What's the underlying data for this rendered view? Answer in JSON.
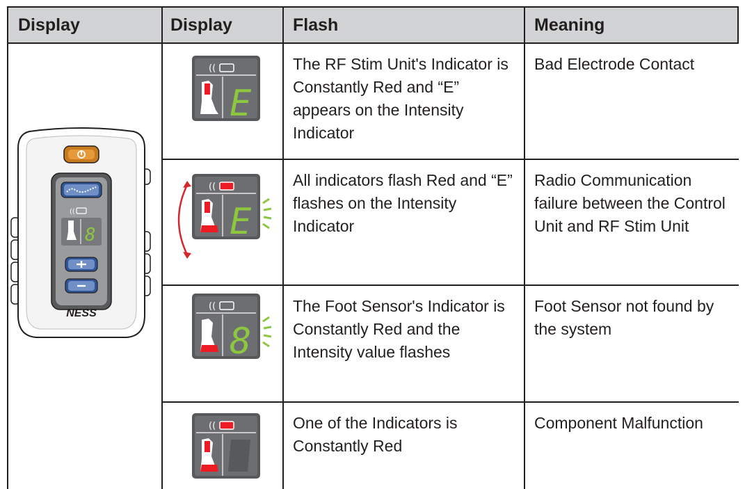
{
  "header": {
    "col1": "Display",
    "col2": "Display",
    "col3": "Flash",
    "col4": "Meaning"
  },
  "device": {
    "brand": "NESS",
    "intensity_digit": "8",
    "power_icon": "power-icon",
    "wave_icon": "stimulation-wave-icon",
    "plus_icon": "plus-icon",
    "minus_icon": "minus-icon"
  },
  "rows": [
    {
      "panel_digit": "E",
      "flash": "The RF Stim Unit's Indicator is Constantly Red and “E” appears on the Intensity Indicator",
      "meaning": "Bad Electrode Contact"
    },
    {
      "panel_digit": "E",
      "flash": "All indicators flash Red and “E” flashes on the Intensity Indicator",
      "meaning": "Radio Communication failure between the Control Unit and RF Stim Unit"
    },
    {
      "panel_digit": "8",
      "flash": "The Foot Sensor's Indicator is Constantly Red and the Intensity value flashes",
      "meaning": "Foot Sensor not found by the system"
    },
    {
      "panel_digit": "",
      "flash": "One of the Indicators is Constantly Red",
      "meaning": "Component Malfunction"
    }
  ],
  "colors": {
    "header_bg": "#d1d3d4",
    "panel_bg": "#58595b",
    "indicator_red": "#ed1c24",
    "digit_green": "#8dc63f",
    "power_orange": "#c87a1e",
    "button_blue": "#4a6fa5",
    "flash_arrow_red": "#d7262b"
  }
}
